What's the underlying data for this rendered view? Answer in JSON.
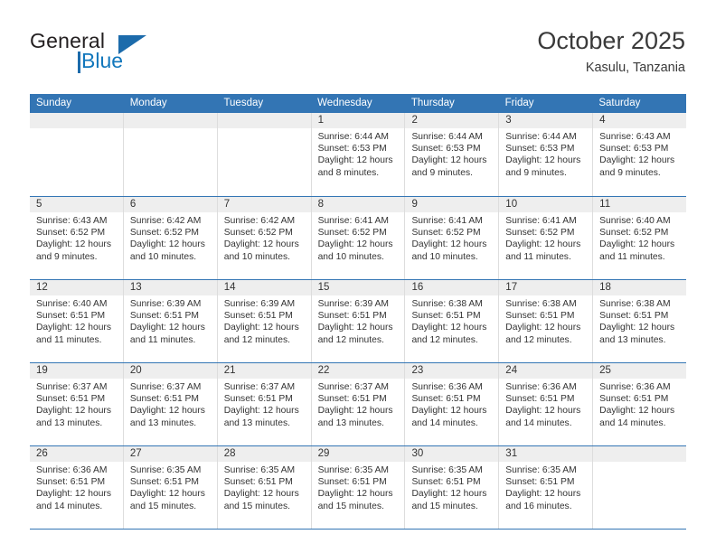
{
  "brand": {
    "word1": "General",
    "word2": "Blue",
    "triangle_color": "#1c6bab",
    "blue_color": "#1277bc"
  },
  "header": {
    "month_title": "October 2025",
    "location": "Kasulu, Tanzania"
  },
  "calendar": {
    "header_bg": "#3375b4",
    "weekdays": [
      "Sunday",
      "Monday",
      "Tuesday",
      "Wednesday",
      "Thursday",
      "Friday",
      "Saturday"
    ],
    "weeks": [
      [
        {
          "day": "",
          "lines": []
        },
        {
          "day": "",
          "lines": []
        },
        {
          "day": "",
          "lines": []
        },
        {
          "day": "1",
          "lines": [
            "Sunrise: 6:44 AM",
            "Sunset: 6:53 PM",
            "Daylight: 12 hours",
            "and 8 minutes."
          ]
        },
        {
          "day": "2",
          "lines": [
            "Sunrise: 6:44 AM",
            "Sunset: 6:53 PM",
            "Daylight: 12 hours",
            "and 9 minutes."
          ]
        },
        {
          "day": "3",
          "lines": [
            "Sunrise: 6:44 AM",
            "Sunset: 6:53 PM",
            "Daylight: 12 hours",
            "and 9 minutes."
          ]
        },
        {
          "day": "4",
          "lines": [
            "Sunrise: 6:43 AM",
            "Sunset: 6:53 PM",
            "Daylight: 12 hours",
            "and 9 minutes."
          ]
        }
      ],
      [
        {
          "day": "5",
          "lines": [
            "Sunrise: 6:43 AM",
            "Sunset: 6:52 PM",
            "Daylight: 12 hours",
            "and 9 minutes."
          ]
        },
        {
          "day": "6",
          "lines": [
            "Sunrise: 6:42 AM",
            "Sunset: 6:52 PM",
            "Daylight: 12 hours",
            "and 10 minutes."
          ]
        },
        {
          "day": "7",
          "lines": [
            "Sunrise: 6:42 AM",
            "Sunset: 6:52 PM",
            "Daylight: 12 hours",
            "and 10 minutes."
          ]
        },
        {
          "day": "8",
          "lines": [
            "Sunrise: 6:41 AM",
            "Sunset: 6:52 PM",
            "Daylight: 12 hours",
            "and 10 minutes."
          ]
        },
        {
          "day": "9",
          "lines": [
            "Sunrise: 6:41 AM",
            "Sunset: 6:52 PM",
            "Daylight: 12 hours",
            "and 10 minutes."
          ]
        },
        {
          "day": "10",
          "lines": [
            "Sunrise: 6:41 AM",
            "Sunset: 6:52 PM",
            "Daylight: 12 hours",
            "and 11 minutes."
          ]
        },
        {
          "day": "11",
          "lines": [
            "Sunrise: 6:40 AM",
            "Sunset: 6:52 PM",
            "Daylight: 12 hours",
            "and 11 minutes."
          ]
        }
      ],
      [
        {
          "day": "12",
          "lines": [
            "Sunrise: 6:40 AM",
            "Sunset: 6:51 PM",
            "Daylight: 12 hours",
            "and 11 minutes."
          ]
        },
        {
          "day": "13",
          "lines": [
            "Sunrise: 6:39 AM",
            "Sunset: 6:51 PM",
            "Daylight: 12 hours",
            "and 11 minutes."
          ]
        },
        {
          "day": "14",
          "lines": [
            "Sunrise: 6:39 AM",
            "Sunset: 6:51 PM",
            "Daylight: 12 hours",
            "and 12 minutes."
          ]
        },
        {
          "day": "15",
          "lines": [
            "Sunrise: 6:39 AM",
            "Sunset: 6:51 PM",
            "Daylight: 12 hours",
            "and 12 minutes."
          ]
        },
        {
          "day": "16",
          "lines": [
            "Sunrise: 6:38 AM",
            "Sunset: 6:51 PM",
            "Daylight: 12 hours",
            "and 12 minutes."
          ]
        },
        {
          "day": "17",
          "lines": [
            "Sunrise: 6:38 AM",
            "Sunset: 6:51 PM",
            "Daylight: 12 hours",
            "and 12 minutes."
          ]
        },
        {
          "day": "18",
          "lines": [
            "Sunrise: 6:38 AM",
            "Sunset: 6:51 PM",
            "Daylight: 12 hours",
            "and 13 minutes."
          ]
        }
      ],
      [
        {
          "day": "19",
          "lines": [
            "Sunrise: 6:37 AM",
            "Sunset: 6:51 PM",
            "Daylight: 12 hours",
            "and 13 minutes."
          ]
        },
        {
          "day": "20",
          "lines": [
            "Sunrise: 6:37 AM",
            "Sunset: 6:51 PM",
            "Daylight: 12 hours",
            "and 13 minutes."
          ]
        },
        {
          "day": "21",
          "lines": [
            "Sunrise: 6:37 AM",
            "Sunset: 6:51 PM",
            "Daylight: 12 hours",
            "and 13 minutes."
          ]
        },
        {
          "day": "22",
          "lines": [
            "Sunrise: 6:37 AM",
            "Sunset: 6:51 PM",
            "Daylight: 12 hours",
            "and 13 minutes."
          ]
        },
        {
          "day": "23",
          "lines": [
            "Sunrise: 6:36 AM",
            "Sunset: 6:51 PM",
            "Daylight: 12 hours",
            "and 14 minutes."
          ]
        },
        {
          "day": "24",
          "lines": [
            "Sunrise: 6:36 AM",
            "Sunset: 6:51 PM",
            "Daylight: 12 hours",
            "and 14 minutes."
          ]
        },
        {
          "day": "25",
          "lines": [
            "Sunrise: 6:36 AM",
            "Sunset: 6:51 PM",
            "Daylight: 12 hours",
            "and 14 minutes."
          ]
        }
      ],
      [
        {
          "day": "26",
          "lines": [
            "Sunrise: 6:36 AM",
            "Sunset: 6:51 PM",
            "Daylight: 12 hours",
            "and 14 minutes."
          ]
        },
        {
          "day": "27",
          "lines": [
            "Sunrise: 6:35 AM",
            "Sunset: 6:51 PM",
            "Daylight: 12 hours",
            "and 15 minutes."
          ]
        },
        {
          "day": "28",
          "lines": [
            "Sunrise: 6:35 AM",
            "Sunset: 6:51 PM",
            "Daylight: 12 hours",
            "and 15 minutes."
          ]
        },
        {
          "day": "29",
          "lines": [
            "Sunrise: 6:35 AM",
            "Sunset: 6:51 PM",
            "Daylight: 12 hours",
            "and 15 minutes."
          ]
        },
        {
          "day": "30",
          "lines": [
            "Sunrise: 6:35 AM",
            "Sunset: 6:51 PM",
            "Daylight: 12 hours",
            "and 15 minutes."
          ]
        },
        {
          "day": "31",
          "lines": [
            "Sunrise: 6:35 AM",
            "Sunset: 6:51 PM",
            "Daylight: 12 hours",
            "and 16 minutes."
          ]
        },
        {
          "day": "",
          "lines": []
        }
      ]
    ]
  }
}
